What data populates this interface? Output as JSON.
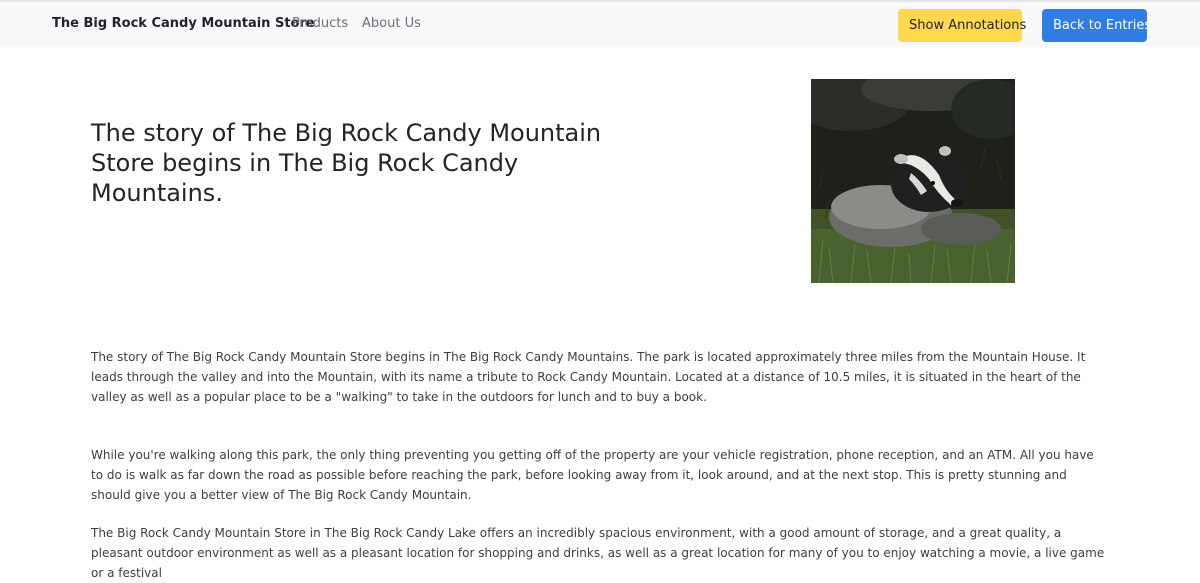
{
  "navbar": {
    "brand": "The Big Rock Candy Mountain Store",
    "links": [
      "Products",
      "About Us"
    ],
    "show_annotations_label": "Show Annotations",
    "back_label": "Back to Entries",
    "colors": {
      "annotations_button": "#ffd84d",
      "back_button": "#2f7ee6",
      "navbar_bg": "#f8f9fa"
    }
  },
  "main": {
    "headline": "The story of The Big Rock Candy Mountain Store begins in The Big Rock Candy Mountains.",
    "image": {
      "subject": "badger-photo"
    },
    "paragraphs": [
      "The story of The Big Rock Candy Mountain Store begins in The Big Rock Candy Mountains. The park is located approximately three miles from the Mountain House. It leads through the valley and into the Mountain, with its name a tribute to Rock Candy Mountain. Located at a distance of 10.5 miles, it is situated in the heart of the valley as well as a popular place to be a \"walking\" to take in the outdoors for lunch and to buy a book.",
      "While you're walking along this park, the only thing preventing you getting off of the property are your vehicle registration, phone reception, and an ATM. All you have to do is walk as far down the road as possible before reaching the park, before looking away from it, look around, and at the next stop. This is pretty stunning and should give you a better view of The Big Rock Candy Mountain.",
      "The Big Rock Candy Mountain Store in The Big Rock Candy Lake offers an incredibly spacious environment, with a good amount of storage, and a great quality, a pleasant outdoor environment as well as a pleasant location for shopping and drinks, as well as a great location for many of you to enjoy watching a movie, a live game or a festival"
    ]
  }
}
